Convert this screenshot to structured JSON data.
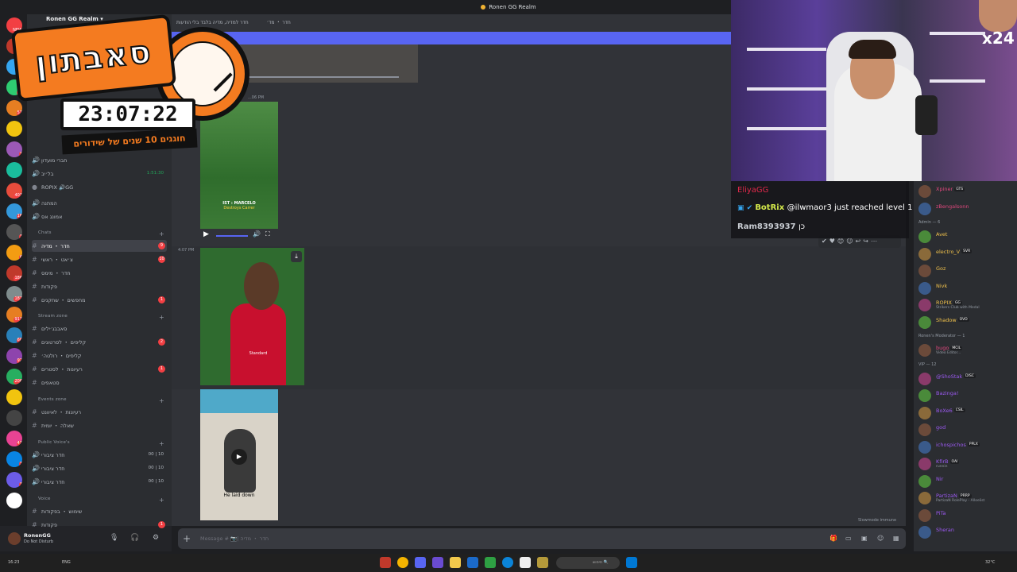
{
  "window": {
    "title": "Ronen GG Realm"
  },
  "server": {
    "name": "Ronen GG Realm"
  },
  "rail": [
    {
      "badge": "NEW"
    },
    {
      "badge": "100"
    },
    {
      "badge": "5"
    },
    {
      "badge": "80"
    },
    {
      "badge": "57"
    },
    {
      "badge": ""
    },
    {
      "badge": "1"
    },
    {
      "badge": ""
    },
    {
      "badge": "403"
    },
    {
      "badge": "16"
    },
    {
      "badge": "3"
    },
    {
      "badge": "6"
    },
    {
      "badge": "186"
    },
    {
      "badge": "187"
    },
    {
      "badge": "913"
    },
    {
      "badge": "60"
    },
    {
      "badge": "92"
    },
    {
      "badge": "206"
    },
    {
      "badge": ""
    },
    {
      "badge": ""
    },
    {
      "badge": "43"
    },
    {
      "badge": "3"
    },
    {
      "badge": "3"
    },
    {
      "badge": ""
    }
  ],
  "channels": [
    {
      "label": "חברי מועדון",
      "type": "voice"
    },
    {
      "label": "בל׳יב",
      "type": "voice",
      "extra": "1:51:30"
    },
    {
      "label": "ROPIX 🔊GG",
      "type": "user"
    },
    {
      "label": "המתנה",
      "type": "voice"
    },
    {
      "label": "אמונג אס",
      "type": "voice"
    }
  ],
  "categories": {
    "chats": "Chats",
    "stream": "Stream zone",
    "events": "Events zone",
    "public_voice": "Public Voice's",
    "voice": "Voice"
  },
  "chats": [
    {
      "label": "חדר ・ מדיה",
      "count": "9"
    },
    {
      "label": "צ׳אט ・ ראשי",
      "count": "10"
    },
    {
      "label": "חדר ・ מימס",
      "count": ""
    },
    {
      "label": "פקודות",
      "count": ""
    },
    {
      "label": "מחפשים ・ שחקנים",
      "count": "1"
    }
  ],
  "stream": [
    {
      "label": "סאבבג׳ילים",
      "count": ""
    },
    {
      "label": "קליפים ・ לסרטונים",
      "count": "2"
    },
    {
      "label": "קליפים ・ רולטה׳",
      "count": ""
    },
    {
      "label": "רעיונות ・ לסטרים",
      "count": "1"
    },
    {
      "label": "סטאפים",
      "count": ""
    }
  ],
  "events": [
    {
      "label": "רעיונות ・ לאיוונט",
      "count": ""
    },
    {
      "label": "שאלה ・ יומית",
      "count": ""
    }
  ],
  "public_voice": [
    {
      "label": "חדר ציבורי",
      "v1": "00",
      "v2": "10"
    },
    {
      "label": "חדר ציבורי",
      "v1": "00",
      "v2": "10"
    },
    {
      "label": "חדר ציבורי",
      "v1": "00",
      "v2": "10"
    }
  ],
  "voice": [
    {
      "label": "שימוש ・ בפקודות",
      "count": ""
    },
    {
      "label": "פקודות",
      "count": "1"
    }
  ],
  "user": {
    "name": "RonenGG",
    "status": "Do Not Disturb"
  },
  "header": {
    "channel": "חדר ・ מד׳",
    "topic": "חדר למדיה, מדיה בלבד בלי הודעות"
  },
  "messages": {
    "ts1": "...06 PM",
    "ts2": "4:07 PM",
    "vid2_caption": "IST : MARCELO",
    "vid2_caption2": "Destroys Carrer",
    "vid4_caption": "He laid down"
  },
  "composer": {
    "placeholder": "Message # 📷| חדר ・ מדיה",
    "slowmode": "Slowmode immune"
  },
  "overlay_chat": [
    {
      "name": "EliyaGG",
      "text": "",
      "color": "#e0284a"
    },
    {
      "name": "BotRix",
      "text": "@ilwmaor3 just reached level 1",
      "color": "#d4e94a"
    },
    {
      "name": "Ram8393937",
      "text": "כן",
      "color": "#c9cdd3"
    }
  ],
  "timer": {
    "title": "סאבתון",
    "time": "23:07:22",
    "subtitle": "חוגגים 10 שנים של שידורים"
  },
  "cam": {
    "multiplier": "x24"
  },
  "members": [
    {
      "name": "Xpiner",
      "tag": "GTS",
      "color": "#e0477d",
      "sub": ""
    },
    {
      "name": "zBengalsonn",
      "tag": "",
      "color": "#e0477d",
      "sub": ""
    },
    {
      "group": "Admin — 6"
    },
    {
      "name": "Avet",
      "tag": "",
      "color": "#f0c14b",
      "sub": ""
    },
    {
      "name": "electro_V",
      "tag": "SVR",
      "color": "#f0c14b",
      "sub": ""
    },
    {
      "name": "Goz",
      "tag": "",
      "color": "#f0c14b",
      "sub": ""
    },
    {
      "name": "Nivk",
      "tag": "",
      "color": "#f0c14b",
      "sub": ""
    },
    {
      "name": "ROPIX",
      "tag": "GG",
      "color": "#f0c14b",
      "sub": "Strikers Club with Medal"
    },
    {
      "name": "Shadow",
      "tag": "OVO",
      "color": "#f0c14b",
      "sub": ""
    },
    {
      "group": "Ronen's Moderator — 1"
    },
    {
      "name": "bugo",
      "tag": "MCIL",
      "color": "#e0477d",
      "sub": "Video Editor..."
    },
    {
      "group": "VIP — 12"
    },
    {
      "name": "@ShoStak",
      "tag": "DISC",
      "color": "#9b59f0",
      "sub": ""
    },
    {
      "name": "Bazinga!",
      "tag": "",
      "color": "#9b59f0",
      "sub": ""
    },
    {
      "name": "BoXe6",
      "tag": "CSIL",
      "color": "#9b59f0",
      "sub": ""
    },
    {
      "name": "god",
      "tag": "",
      "color": "#9b59f0",
      "sub": ""
    },
    {
      "name": "ichospichos",
      "tag": "PPLX",
      "color": "#9b59f0",
      "sub": ""
    },
    {
      "name": "KfirB",
      "tag": "OAI",
      "color": "#9b59f0",
      "sub": "runnin"
    },
    {
      "name": "Nir",
      "tag": "",
      "color": "#9b59f0",
      "sub": ""
    },
    {
      "name": "PartizaN",
      "tag": "PRRP",
      "color": "#9b59f0",
      "sub": "PartizaN RolePlay - Alloelist"
    },
    {
      "name": "PiTa",
      "tag": "",
      "color": "#9b59f0",
      "sub": ""
    },
    {
      "name": "Sheran",
      "tag": "",
      "color": "#9b59f0",
      "sub": ""
    }
  ],
  "taskbar": {
    "time": "16:23",
    "date": "10/08/2026",
    "lang": "ENG",
    "temp": "32°C",
    "search": "חיפוש"
  }
}
